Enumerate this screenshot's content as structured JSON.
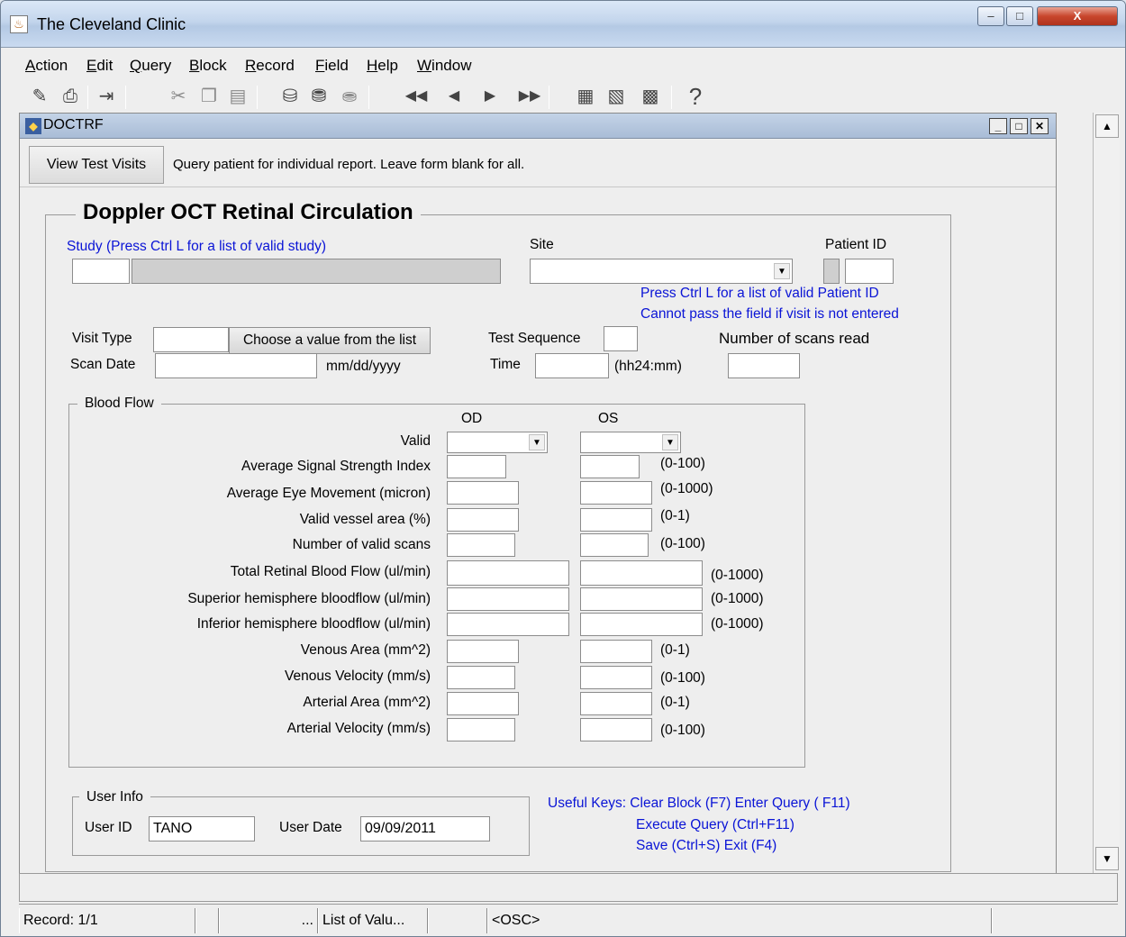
{
  "window": {
    "title": "The Cleveland Clinic",
    "minimize": "–",
    "maximize": "□",
    "close": "X"
  },
  "menu": [
    {
      "label": "Action",
      "u": "A",
      "rest": "ction"
    },
    {
      "label": "Edit",
      "u": "E",
      "rest": "dit"
    },
    {
      "label": "Query",
      "u": "Q",
      "rest": "uery"
    },
    {
      "label": "Block",
      "u": "B",
      "rest": "lock"
    },
    {
      "label": "Record",
      "u": "R",
      "rest": "ecord"
    },
    {
      "label": "Field",
      "u": "F",
      "rest": "ield"
    },
    {
      "label": "Help",
      "u": "H",
      "rest": "elp"
    },
    {
      "label": "Window",
      "u": "W",
      "rest": "indow"
    }
  ],
  "toolbar_icons": [
    "save-icon",
    "print-icon",
    "exit-icon",
    "cut-icon",
    "copy-icon",
    "paste-icon",
    "enter-query-icon",
    "execute-query-icon",
    "cancel-query-icon",
    "first-record-icon",
    "previous-record-icon",
    "next-record-icon",
    "last-record-icon",
    "insert-record-icon",
    "delete-record-icon",
    "lock-record-icon",
    "help-icon"
  ],
  "form": {
    "window_title": "DOCTRF",
    "view_button": "View Test Visits",
    "hint": "Query patient for individual report. Leave form blank for all.",
    "heading": "Doppler OCT Retinal Circulation",
    "study_label": "Study (Press Ctrl L for a list of valid study)",
    "site_label": "Site",
    "patient_id_label": "Patient ID",
    "patient_hint1": "Press Ctrl L for a list of valid Patient ID",
    "patient_hint2": "Cannot pass the field if visit is not entered",
    "visit_type_label": "Visit Type",
    "choose_button": "Choose a value from the list",
    "test_sequence_label": "Test Sequence",
    "num_scans_label": "Number of scans read",
    "scan_date_label": "Scan Date",
    "scan_date_format": "mm/dd/yyyy",
    "time_label": "Time",
    "time_format": "(hh24:mm)"
  },
  "blood_flow": {
    "legend": "Blood Flow",
    "od": "OD",
    "os": "OS",
    "valid_label": "Valid",
    "rows": [
      {
        "label": "Average Signal Strength Index",
        "range": "(0-100)"
      },
      {
        "label": "Average Eye Movement (micron)",
        "range": "(0-1000)"
      },
      {
        "label": "Valid vessel area (%)",
        "range": "(0-1)"
      },
      {
        "label": "Number of valid scans",
        "range": "(0-100)"
      },
      {
        "label": "Total Retinal Blood Flow  (ul/min)",
        "range": "(0-1000)"
      },
      {
        "label": "Superior hemisphere bloodflow  (ul/min)",
        "range": "(0-1000)"
      },
      {
        "label": "Inferior hemisphere bloodflow  (ul/min)",
        "range": "(0-1000)"
      },
      {
        "label": "Venous Area (mm^2)",
        "range": "(0-1)"
      },
      {
        "label": "Venous Velocity (mm/s)",
        "range": "(0-100)"
      },
      {
        "label": "Arterial Area (mm^2)",
        "range": "(0-1)"
      },
      {
        "label": "Arterial Velocity (mm/s)",
        "range": "(0-100)"
      }
    ]
  },
  "user_info": {
    "legend": "User Info",
    "user_id_label": "User ID",
    "user_id": "TANO",
    "user_date_label": "User Date",
    "user_date": "09/09/2011"
  },
  "useful_keys": {
    "line1": "Useful Keys: Clear Block (F7)    Enter Query ( F11)",
    "line2": "Execute Query (Ctrl+F11)",
    "line3": "Save (Ctrl+S)    Exit (F4)"
  },
  "status": {
    "record": "Record: 1/1",
    "dots": "...",
    "lov": "List of Valu...",
    "osc": "<OSC>"
  }
}
